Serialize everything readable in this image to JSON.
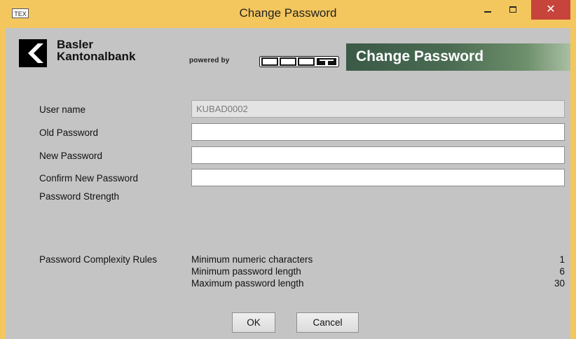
{
  "window": {
    "title": "Change Password",
    "app_icon_text": "TEX",
    "close_glyph": "✕"
  },
  "header": {
    "bank_name_line1": "Basler",
    "bank_name_line2": "Kantonalbank",
    "powered_by": "powered by",
    "product_logo": "360T",
    "banner_title": "Change Password"
  },
  "form": {
    "user_name_label": "User name",
    "user_name_value": "KUBAD0002",
    "old_password_label": "Old Password",
    "old_password_value": "",
    "new_password_label": "New Password",
    "new_password_value": "",
    "confirm_password_label": "Confirm New Password",
    "confirm_password_value": "",
    "strength_label": "Password Strength"
  },
  "rules": {
    "title": "Password Complexity Rules",
    "items": [
      {
        "name": "Minimum numeric characters",
        "value": "1"
      },
      {
        "name": "Minimum password length",
        "value": "6"
      },
      {
        "name": "Maximum password length",
        "value": "30"
      }
    ]
  },
  "buttons": {
    "ok": "OK",
    "cancel": "Cancel"
  },
  "colors": {
    "titlebar": "#f4c75e",
    "client_bg": "#c4c4c4",
    "close_red": "#c7443c",
    "banner_green": "#3a5a47"
  }
}
